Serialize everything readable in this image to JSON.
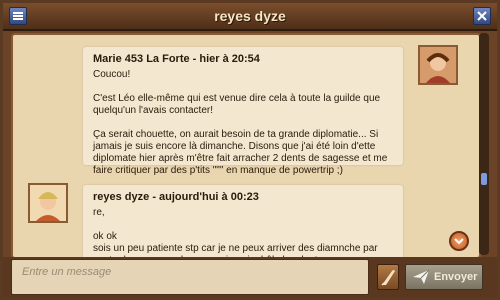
{
  "window": {
    "title": "reyes dyze"
  },
  "messages": [
    {
      "author": "Marie 453 La Forte - hier à 20:54",
      "lines": [
        "Coucou!",
        "C'est Léo elle-même qui est venue dire cela à toute la guilde que quelqu'un l'avais contacter!",
        "Ça serait chouette, on aurait besoin de ta grande diplomatie... Si jamais je suis encore là dimanche. Disons que j'ai été loin d'ette diplomate hier après m'être fait arracher 2 dents de sagesse et me faire critiquer par des p'tits \"\"\" en manque de powertrip ;)"
      ]
    },
    {
      "author": "reyes dyze - aujourd'hui à 00:23",
      "lines": [
        "re,",
        "ok ok",
        "sois un peu patiente stp car je ne peux arriver des diamnche par contre bonne convalescence, jamais drôle les dents"
      ]
    }
  ],
  "composer": {
    "placeholder": "Entre un message",
    "send_label": "Envoyer"
  },
  "icons": {
    "menu": "menu-icon",
    "close": "close-icon",
    "scroll_down": "chevron-down-icon",
    "attach": "quill-icon",
    "send": "paper-plane-icon"
  }
}
